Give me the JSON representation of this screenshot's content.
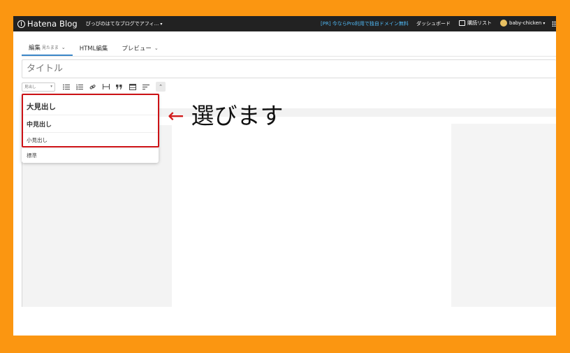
{
  "topbar": {
    "brand": "Hatena Blog",
    "blog_name": "ぴっぴのはてなブログでアフィ...",
    "promo": "[PR] 今ならPro利用で独自ドメイン無料",
    "dashboard": "ダッシュボード",
    "reading_list": "購読リスト",
    "user": "baby-chicken"
  },
  "tabs": [
    {
      "label": "編集",
      "sub": "見たまま"
    },
    {
      "label": "HTML編集"
    },
    {
      "label": "プレビュー"
    }
  ],
  "title_placeholder": "タイトル",
  "toolbar": {
    "format_select": "見出し",
    "buttons": [
      "bulleted-list-icon",
      "numbered-list-icon",
      "link-icon",
      "horizontal-rule-icon",
      "quote-icon",
      "table-icon",
      "more-icon"
    ]
  },
  "dropdown": {
    "items": [
      "大見出し",
      "中見出し",
      "小見出し",
      "標準"
    ]
  },
  "annotation": {
    "arrow": "←",
    "text": "選びます"
  },
  "colors": {
    "border": "#fb9611",
    "highlight": "#cc1216",
    "topbar": "#222222",
    "promo": "#4fb6f1",
    "tab_active": "#3a86c8"
  }
}
